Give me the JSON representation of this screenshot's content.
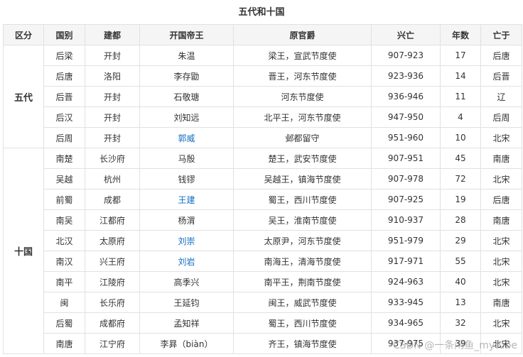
{
  "title": "五代和十国",
  "columns": [
    "区分",
    "国别",
    "建都",
    "开国帝王",
    "原官爵",
    "兴亡",
    "年数",
    "亡于"
  ],
  "groups": [
    {
      "label": "五代",
      "rows": [
        {
          "country": "后梁",
          "capital": "开封",
          "founder": "朱温",
          "founder_link": false,
          "title": "梁王，宣武节度使",
          "years_range": "907-923",
          "years": "17",
          "fell_to": "后唐"
        },
        {
          "country": "后唐",
          "capital": "洛阳",
          "founder": "李存勖",
          "founder_link": false,
          "title": "晋王，河东节度使",
          "years_range": "923-936",
          "years": "14",
          "fell_to": "后晋"
        },
        {
          "country": "后晋",
          "capital": "开封",
          "founder": "石敬瑭",
          "founder_link": false,
          "title": "河东节度使",
          "years_range": "936-946",
          "years": "11",
          "fell_to": "辽"
        },
        {
          "country": "后汉",
          "capital": "开封",
          "founder": "刘知远",
          "founder_link": false,
          "title": "北平王，河东节度使",
          "years_range": "947-950",
          "years": "4",
          "fell_to": "后周"
        },
        {
          "country": "后周",
          "capital": "开封",
          "founder": "郭威",
          "founder_link": true,
          "title": "邺都留守",
          "years_range": "951-960",
          "years": "10",
          "fell_to": "北宋"
        }
      ]
    },
    {
      "label": "十国",
      "rows": [
        {
          "country": "南楚",
          "capital": "长沙府",
          "founder": "马殷",
          "founder_link": false,
          "title": "楚王，武安节度使",
          "years_range": "907-951",
          "years": "45",
          "fell_to": "南唐"
        },
        {
          "country": "吴越",
          "capital": "杭州",
          "founder": "钱镠",
          "founder_link": false,
          "title": "吴越王，镇海节度使",
          "years_range": "907-978",
          "years": "72",
          "fell_to": "北宋"
        },
        {
          "country": "前蜀",
          "capital": "成都",
          "founder": "王建",
          "founder_link": true,
          "title": "蜀王，西川节度使",
          "years_range": "907-925",
          "years": "19",
          "fell_to": "后唐"
        },
        {
          "country": "南吴",
          "capital": "江都府",
          "founder": "杨渭",
          "founder_link": false,
          "title": "吴王，淮南节度使",
          "years_range": "910-937",
          "years": "28",
          "fell_to": "南唐"
        },
        {
          "country": "北汉",
          "capital": "太原府",
          "founder": "刘崇",
          "founder_link": true,
          "title": "太原尹，河东节度使",
          "years_range": "951-979",
          "years": "29",
          "fell_to": "北宋"
        },
        {
          "country": "南汉",
          "capital": "兴王府",
          "founder": "刘岩",
          "founder_link": true,
          "title": "南海王，清海节度使",
          "years_range": "917-971",
          "years": "55",
          "fell_to": "北宋"
        },
        {
          "country": "南平",
          "capital": "江陵府",
          "founder": "高季兴",
          "founder_link": false,
          "title": "南平王，荆南节度使",
          "years_range": "924-963",
          "years": "40",
          "fell_to": "北宋"
        },
        {
          "country": "闽",
          "capital": "长乐府",
          "founder": "王延钧",
          "founder_link": false,
          "title": "闽王，威武节度使",
          "years_range": "933-945",
          "years": "13",
          "fell_to": "南唐"
        },
        {
          "country": "后蜀",
          "capital": "成都府",
          "founder": "孟知祥",
          "founder_link": false,
          "title": "蜀王，西川节度使",
          "years_range": "934-965",
          "years": "32",
          "fell_to": "北宋"
        },
        {
          "country": "南唐",
          "capital": "江宁府",
          "founder": "李昪（biàn）",
          "founder_link": false,
          "title": "齐王，镇海节度使",
          "years_range": "937-975",
          "years": "39",
          "fell_to": "北宋"
        }
      ]
    }
  ],
  "watermark": "CSDN @一条闲鱼_mytube"
}
